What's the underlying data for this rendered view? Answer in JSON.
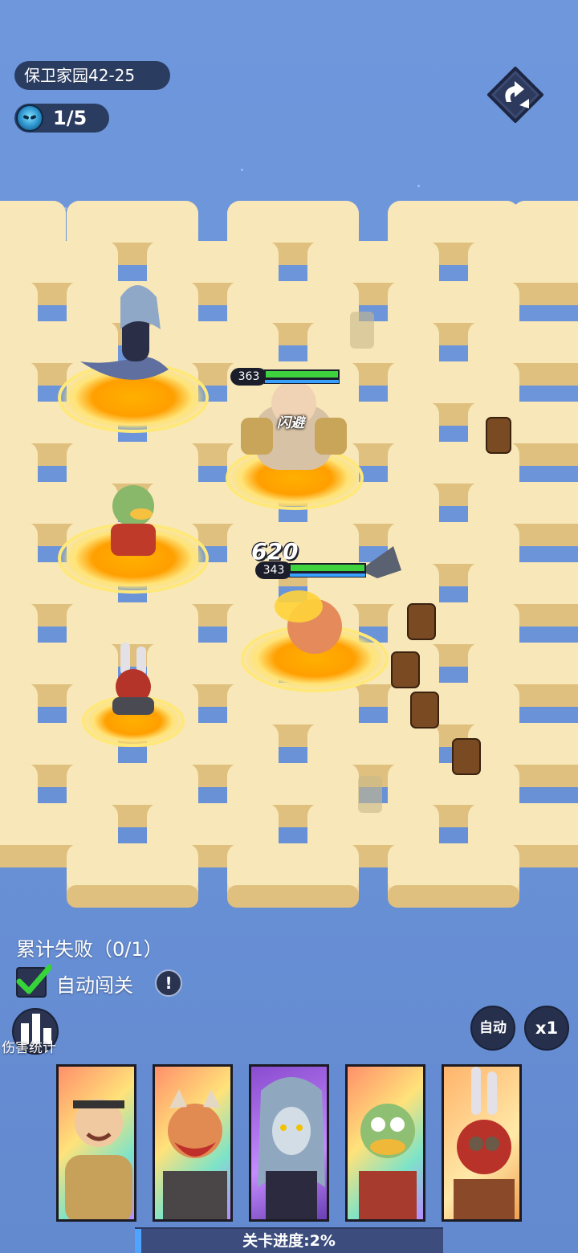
{
  "hud": {
    "stage_label": "保卫家园42-25",
    "wave_counter": "1/5",
    "exit_icon": "exit-arrow-icon"
  },
  "battle": {
    "damage_popup": "620",
    "hero1_hp": "363",
    "hero1_status": "闪避",
    "hero2_hp": "343",
    "colors": {
      "hp_green": "#3fd23f",
      "mana_blue": "#39a0ff"
    }
  },
  "controls": {
    "fail_text": "累计失败（0/1）",
    "auto_challenge_label": "自动闯关",
    "auto_challenge_checked": true,
    "info_icon": "!",
    "damage_stats_label": "伤害统计",
    "auto_button": "自动",
    "speed_button": "x1"
  },
  "heroes": [
    "boar-warrior",
    "red-bull-hero",
    "naga-siren",
    "duck-samurai",
    "rabbit-gunner"
  ],
  "progress": {
    "label": "关卡进度:2%",
    "value": 0.02
  }
}
